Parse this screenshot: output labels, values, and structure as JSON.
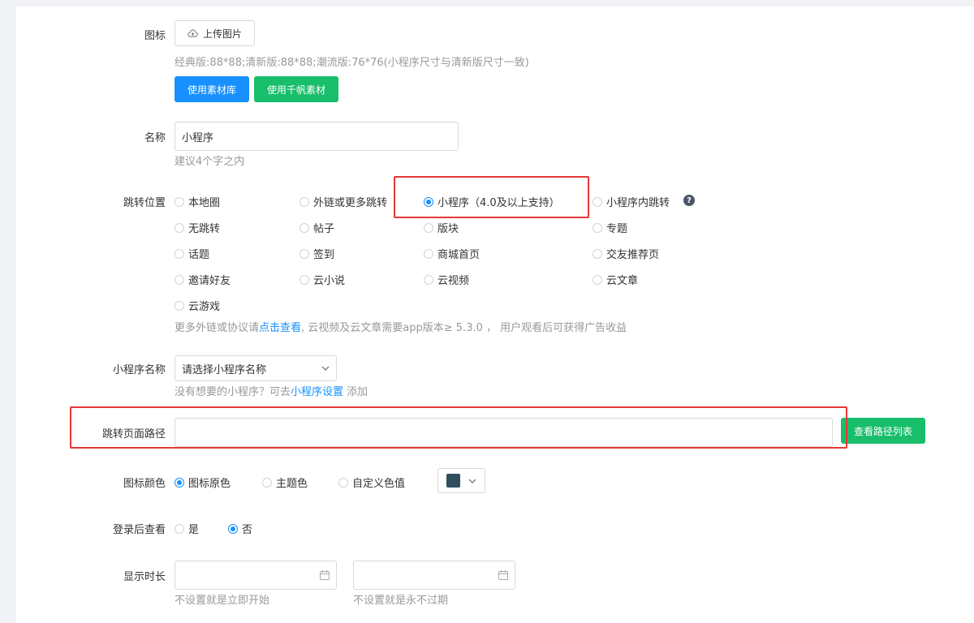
{
  "icon_section": {
    "label": "图标",
    "upload_label": "上传图片",
    "hint": "经典版:88*88;清新版:88*88;潮流版:76*76(小程序尺寸与清新版尺寸一致)",
    "library_button": "使用素材库",
    "qianfan_button": "使用千帆素材"
  },
  "name_section": {
    "label": "名称",
    "value": "小程序",
    "hint": "建议4个字之内"
  },
  "jump_section": {
    "label": "跳转位置",
    "options": [
      {
        "label": "本地圈",
        "checked": false
      },
      {
        "label": "外链或更多跳转",
        "checked": false
      },
      {
        "label": "小程序（4.0及以上支持）",
        "checked": true
      },
      {
        "label": "小程序内跳转",
        "checked": false
      },
      {
        "label": "无跳转",
        "checked": false
      },
      {
        "label": "帖子",
        "checked": false
      },
      {
        "label": "版块",
        "checked": false
      },
      {
        "label": "专题",
        "checked": false
      },
      {
        "label": "话题",
        "checked": false
      },
      {
        "label": "签到",
        "checked": false
      },
      {
        "label": "商城首页",
        "checked": false
      },
      {
        "label": "交友推荐页",
        "checked": false
      },
      {
        "label": "邀请好友",
        "checked": false
      },
      {
        "label": "云小说",
        "checked": false
      },
      {
        "label": "云视频",
        "checked": false
      },
      {
        "label": "云文章",
        "checked": false
      },
      {
        "label": "云游戏",
        "checked": false
      }
    ],
    "help_glyph": "?",
    "hint_prefix": "更多外链或协议请",
    "hint_link": "点击查看",
    "hint_suffix": ", 云视频及云文章需要app版本≥ 5.3.0 ， 用户观看后可获得广告收益"
  },
  "miniapp_section": {
    "label": "小程序名称",
    "select_placeholder": "请选择小程序名称",
    "hint_prefix": "没有想要的小程序？可去",
    "hint_link": "小程序设置",
    "hint_suffix": " 添加"
  },
  "path_section": {
    "label": "跳转页面路径",
    "value": "",
    "button": "查看路径列表"
  },
  "icon_color_section": {
    "label": "图标颜色",
    "options": [
      {
        "label": "图标原色",
        "checked": true
      },
      {
        "label": "主题色",
        "checked": false
      },
      {
        "label": "自定义色值",
        "checked": false
      }
    ],
    "swatch_color": "#2f4f5f"
  },
  "login_section": {
    "label": "登录后查看",
    "options": [
      {
        "label": "是",
        "checked": false
      },
      {
        "label": "否",
        "checked": true
      }
    ]
  },
  "duration_section": {
    "label": "显示时长",
    "start_hint": "不设置就是立即开始",
    "end_hint": "不设置就是永不过期"
  },
  "colors": {
    "primary": "#1890ff",
    "success": "#19be6b",
    "highlight": "#e53935"
  }
}
